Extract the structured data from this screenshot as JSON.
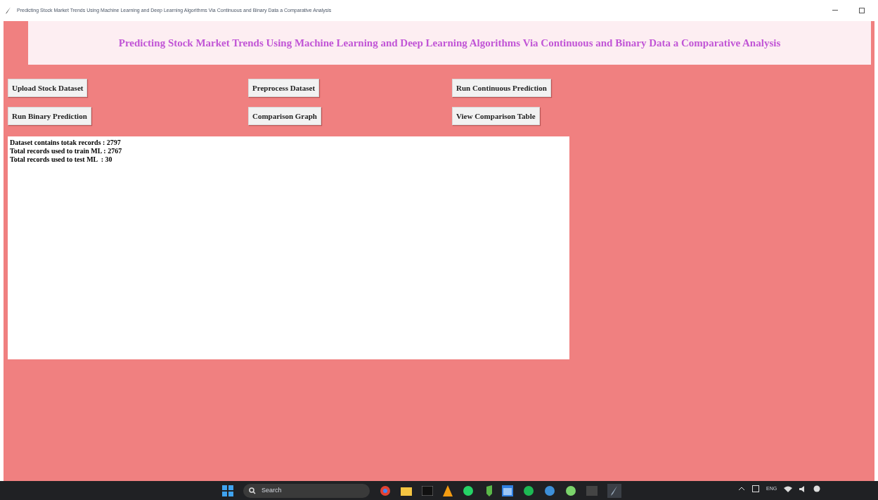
{
  "window": {
    "title": "Predicting Stock Market Trends Using Machine Learning and Deep Learning Algorithms Via Continuous and Binary Data a Comparative Analysis"
  },
  "heading": "Predicting Stock Market Trends Using Machine Learning and Deep Learning Algorithms Via Continuous and Binary Data a Comparative Analysis",
  "buttons": [
    [
      "Upload Stock Dataset",
      "Preprocess Dataset",
      "Run Continuous Prediction"
    ],
    [
      "Run Binary Prediction",
      "Comparison Graph",
      "View Comparison Table"
    ]
  ],
  "output_lines": [
    "Dataset contains totak records : 2797",
    "Total records used to train ML : 2767",
    "Total records used to test ML  : 30"
  ],
  "taskbar": {
    "search_placeholder": "Search",
    "language": "ENG"
  }
}
